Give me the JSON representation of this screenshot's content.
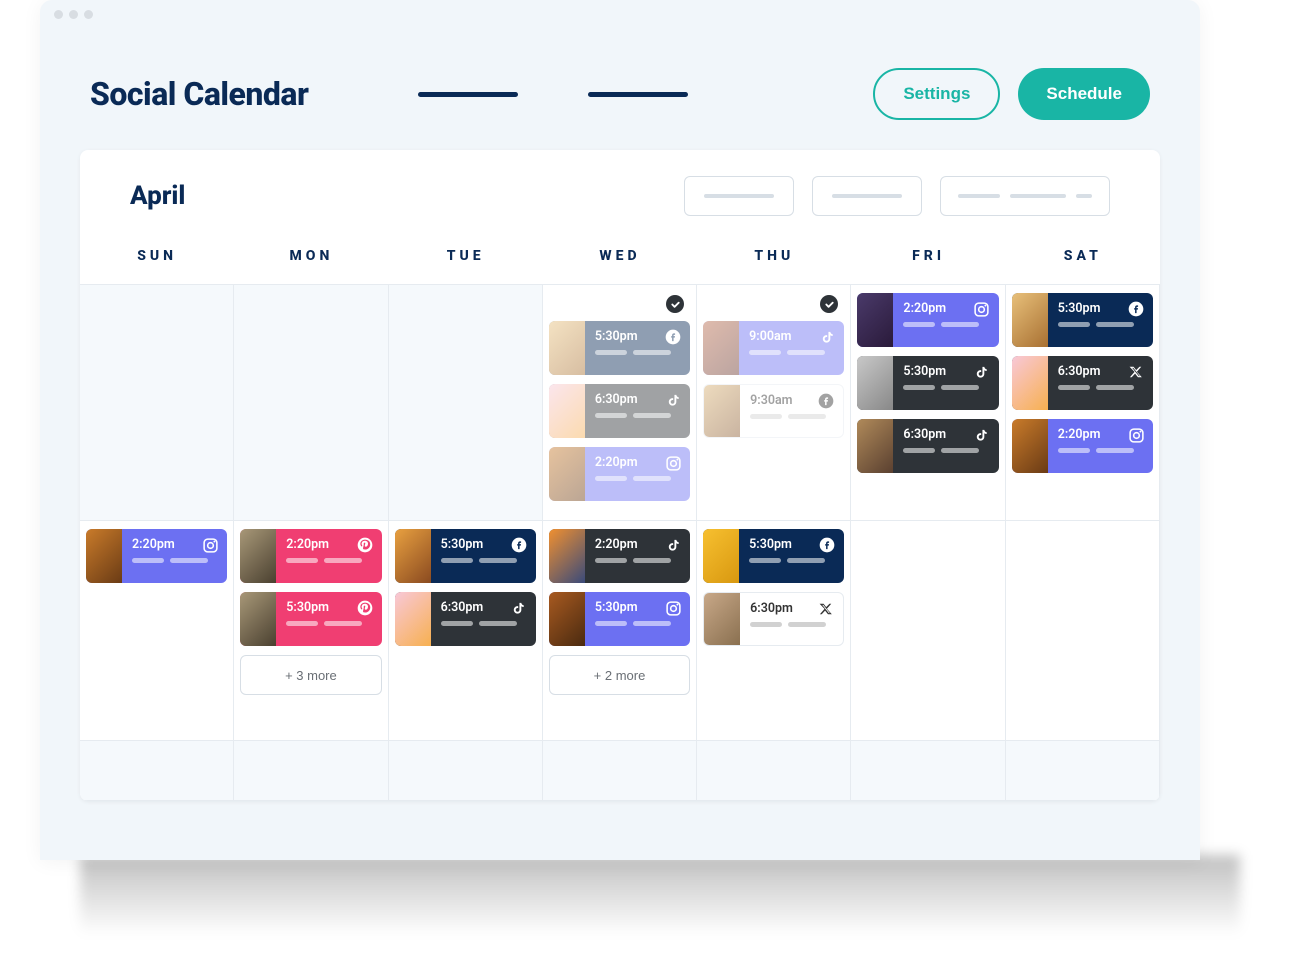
{
  "header": {
    "title": "Social Calendar",
    "settings_label": "Settings",
    "schedule_label": "Schedule"
  },
  "panel": {
    "month": "April"
  },
  "dow": [
    "SUN",
    "MON",
    "TUE",
    "WED",
    "THU",
    "FRI",
    "SAT"
  ],
  "weeks": [
    {
      "cells": [
        {
          "active": false,
          "posts": []
        },
        {
          "active": false,
          "posts": []
        },
        {
          "active": false,
          "posts": []
        },
        {
          "active": true,
          "checked": true,
          "faded": true,
          "posts": [
            {
              "time": "5:30pm",
              "platform": "facebook",
              "color": "navy",
              "thumb": "t-cook"
            },
            {
              "time": "6:30pm",
              "platform": "tiktok",
              "color": "dark",
              "thumb": "t-icecream"
            },
            {
              "time": "2:20pm",
              "platform": "instagram",
              "color": "purple",
              "thumb": "t-burger"
            }
          ]
        },
        {
          "active": true,
          "checked": true,
          "faded": true,
          "posts": [
            {
              "time": "9:00am",
              "platform": "tiktok",
              "color": "purple",
              "thumb": "t-girl"
            },
            {
              "time": "9:30am",
              "platform": "facebook",
              "color": "white",
              "thumb": "t-couple"
            }
          ]
        },
        {
          "active": true,
          "posts": [
            {
              "time": "2:20pm",
              "platform": "instagram",
              "color": "purple",
              "thumb": "t-woman"
            },
            {
              "time": "5:30pm",
              "platform": "tiktok",
              "color": "dark",
              "thumb": "t-man"
            },
            {
              "time": "6:30pm",
              "platform": "tiktok",
              "color": "dark",
              "thumb": "t-group"
            }
          ]
        },
        {
          "active": true,
          "posts": [
            {
              "time": "5:30pm",
              "platform": "facebook",
              "color": "navy",
              "thumb": "t-cook"
            },
            {
              "time": "6:30pm",
              "platform": "x",
              "color": "dark",
              "thumb": "t-icecream"
            },
            {
              "time": "2:20pm",
              "platform": "instagram",
              "color": "purple",
              "thumb": "t-burger"
            }
          ]
        }
      ]
    },
    {
      "cells": [
        {
          "active": true,
          "posts": [
            {
              "time": "2:20pm",
              "platform": "instagram",
              "color": "purple",
              "thumb": "t-burger"
            }
          ]
        },
        {
          "active": true,
          "more": "+ 3 more",
          "posts": [
            {
              "time": "2:20pm",
              "platform": "pinterest",
              "color": "pink",
              "thumb": "t-watch"
            },
            {
              "time": "5:30pm",
              "platform": "pinterest",
              "color": "pink",
              "thumb": "t-watch"
            }
          ]
        },
        {
          "active": true,
          "posts": [
            {
              "time": "5:30pm",
              "platform": "facebook",
              "color": "navy",
              "thumb": "t-fries"
            },
            {
              "time": "6:30pm",
              "platform": "tiktok",
              "color": "dark",
              "thumb": "t-icecream"
            }
          ]
        },
        {
          "active": true,
          "more": "+ 2 more",
          "posts": [
            {
              "time": "2:20pm",
              "platform": "tiktok",
              "color": "dark",
              "thumb": "t-car"
            },
            {
              "time": "5:30pm",
              "platform": "instagram",
              "color": "purple",
              "thumb": "t-autumn"
            }
          ]
        },
        {
          "active": true,
          "posts": [
            {
              "time": "5:30pm",
              "platform": "facebook",
              "color": "navy",
              "thumb": "t-yellow"
            },
            {
              "time": "6:30pm",
              "platform": "x",
              "color": "white",
              "thumb": "t-hair"
            }
          ]
        },
        {
          "active": true,
          "posts": []
        },
        {
          "active": true,
          "posts": []
        }
      ]
    },
    {
      "cells": [
        {
          "active": false
        },
        {
          "active": false
        },
        {
          "active": false
        },
        {
          "active": false
        },
        {
          "active": false
        },
        {
          "active": false
        },
        {
          "active": false
        }
      ]
    }
  ],
  "icons": {
    "facebook": "f",
    "instagram": "ig",
    "tiktok": "tt",
    "pinterest": "p",
    "x": "x"
  }
}
